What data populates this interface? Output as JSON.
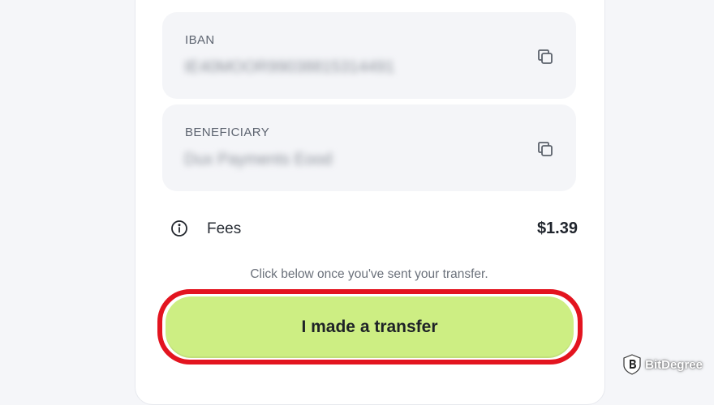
{
  "account_fields": [
    {
      "label": "IBAN",
      "value": "IE40MOOR99038815314491"
    },
    {
      "label": "BENEFICIARY",
      "value": "Dux Payments Eood"
    }
  ],
  "fees": {
    "label": "Fees",
    "amount": "$1.39"
  },
  "transfer": {
    "hint": "Click below once you've sent your transfer.",
    "button_label": "I made a transfer"
  },
  "watermark": {
    "text": "BitDegree"
  },
  "colors": {
    "cta_background": "#cdee83",
    "highlight_outline": "#e3141f",
    "field_background": "#f4f5f8"
  },
  "icons": {
    "copy": "copy-icon",
    "info": "info-icon",
    "brand": "bitdegree-logo-icon"
  }
}
